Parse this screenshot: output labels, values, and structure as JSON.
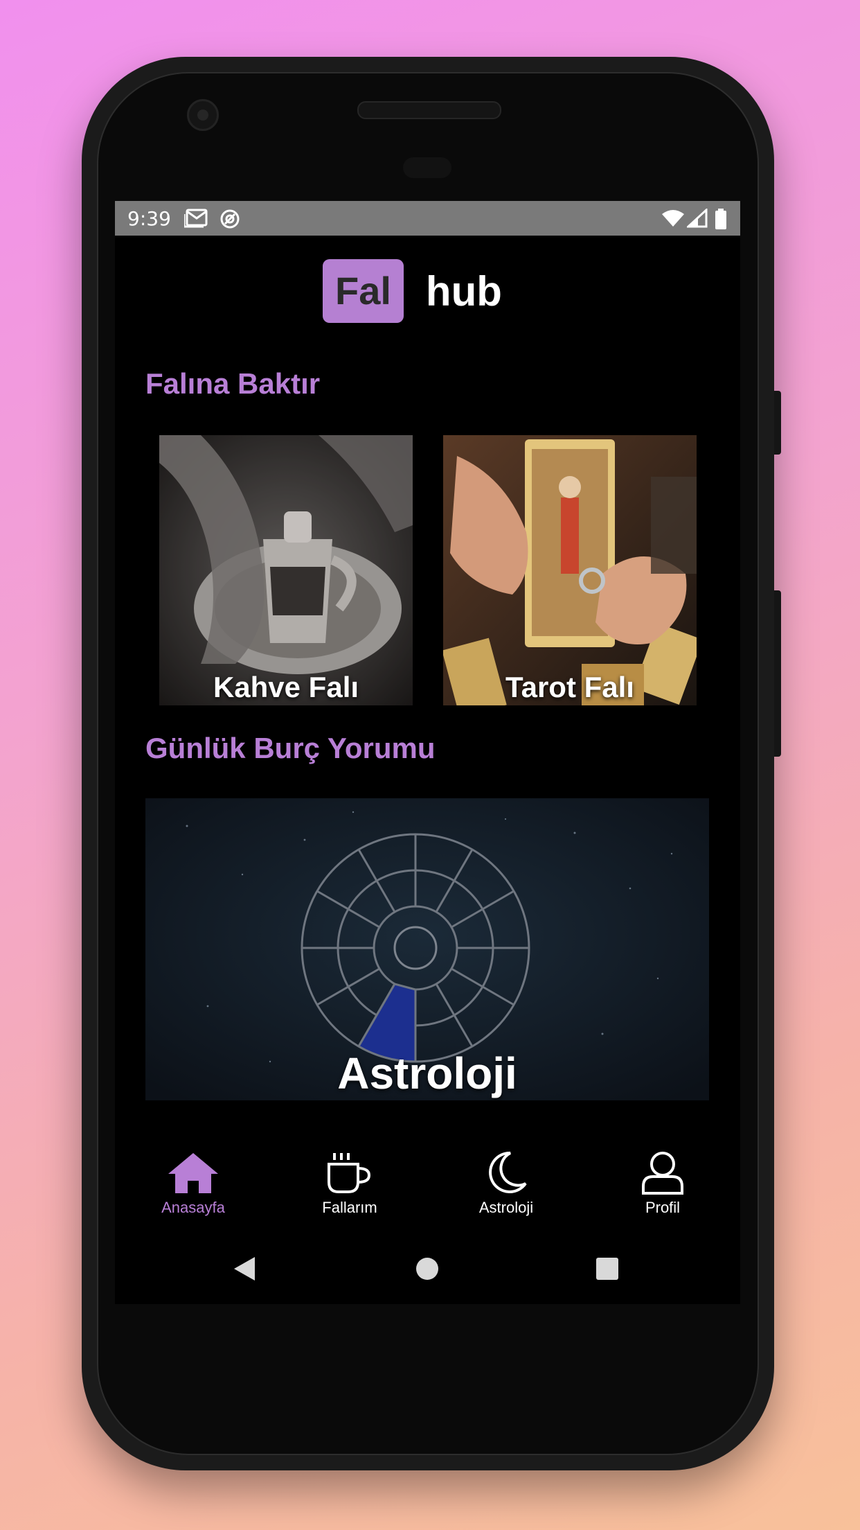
{
  "status_bar": {
    "time": "9:39",
    "icons": [
      "gmail-icon",
      "sync-icon",
      "wifi-icon",
      "signal-icon",
      "battery-icon"
    ]
  },
  "header": {
    "logo_box_text": "Fal",
    "logo_text": "hub",
    "logo_accent_color": "#b580d2"
  },
  "sections": {
    "fortune_title": "Falına Baktır",
    "horoscope_title": "Günlük Burç Yorumu"
  },
  "cards": {
    "coffee_label": "Kahve Falı",
    "tarot_label": "Tarot Falı",
    "astrology_label": "Astroloji"
  },
  "bottom_nav": {
    "items": [
      {
        "label": "Anasayfa",
        "icon": "home-icon",
        "active": true
      },
      {
        "label": "Fallarım",
        "icon": "coffee-cup-icon",
        "active": false
      },
      {
        "label": "Astroloji",
        "icon": "moon-icon",
        "active": false
      },
      {
        "label": "Profil",
        "icon": "user-icon",
        "active": false
      }
    ]
  },
  "colors": {
    "accent": "#b87fd6",
    "background": "#000000"
  }
}
